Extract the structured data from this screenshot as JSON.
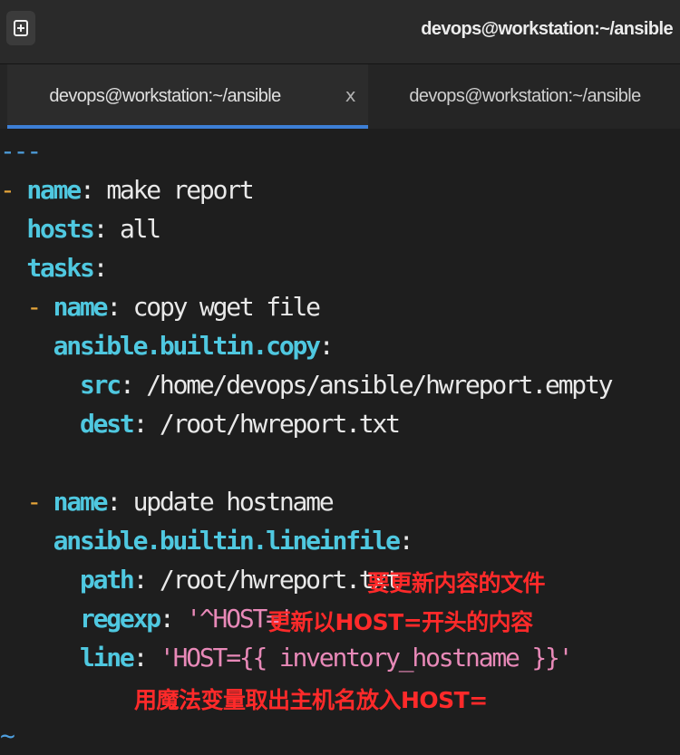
{
  "window": {
    "title": "devops@workstation:~/ansible",
    "new_tab_icon": "new-tab-icon"
  },
  "tabs": [
    {
      "label": "devops@workstation:~/ansible",
      "close": "x",
      "active": true
    },
    {
      "label": "devops@workstation:~/ansible",
      "active": false
    }
  ],
  "editor": {
    "doc_start": "---",
    "play_dash": "-",
    "play_name_key": "name",
    "play_name_value": "make report",
    "hosts_key": "hosts",
    "hosts_value": "all",
    "tasks_key": "tasks",
    "task1_dash": "-",
    "task1_name_key": "name",
    "task1_name_value": "copy wget file",
    "task1_module": "ansible.builtin.copy",
    "src_key": "src",
    "src_value": "/home/devops/ansible/hwreport.empty",
    "dest_key": "dest",
    "dest_value": "/root/hwreport.txt",
    "task2_dash": "-",
    "task2_name_key": "name",
    "task2_name_value": "update hostname",
    "task2_module": "ansible.builtin.lineinfile",
    "path_key": "path",
    "path_value": "/root/hwreport.txt",
    "regexp_key": "regexp",
    "regexp_value": "'^HOST='",
    "line_key": "line",
    "line_value": "'HOST={{ inventory_hostname }}'",
    "tilde": "~"
  },
  "annotations": {
    "path_note": "要更新内容的文件",
    "regexp_note": "更新以HOST=开头的内容",
    "line_note": "用魔法变量取出主机名放入HOST="
  }
}
